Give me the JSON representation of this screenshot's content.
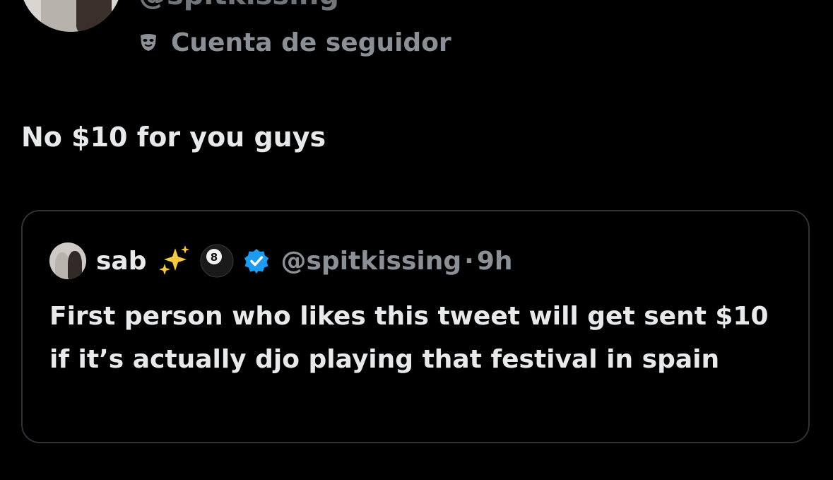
{
  "author": {
    "handle": "@spitkissing",
    "account_label": "Cuenta de seguidor",
    "account_icon": "mask-icon"
  },
  "tweet": {
    "text": "No $10 for you guys"
  },
  "quoted_tweet": {
    "name": "sab",
    "emojis": [
      "sparkles-icon",
      "pool-8-ball-icon"
    ],
    "verified": true,
    "verified_color": "#1d9bf0",
    "handle": "@spitkissing",
    "separator": "·",
    "time": "9h",
    "text": "First person who likes this tweet will get sent $10 if it’s actually djo playing that festival in spain"
  },
  "colors": {
    "background": "#000000",
    "text_primary": "#e7e9ea",
    "text_secondary": "#8b9096",
    "border": "#2f3336"
  }
}
